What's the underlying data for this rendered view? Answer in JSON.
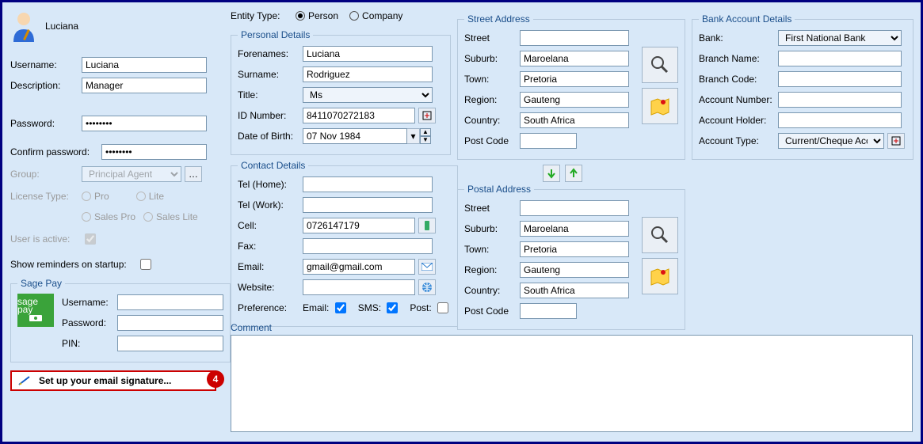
{
  "user": {
    "display_name": "Luciana",
    "username_label": "Username:",
    "username": "Luciana",
    "description_label": "Description:",
    "description": "Manager",
    "password_label": "Password:",
    "password": "********",
    "confirm_label": "Confirm password:",
    "confirm": "********",
    "group_label": "Group:",
    "group_value": "Principal Agent",
    "license_label": "License Type:",
    "license_options": {
      "pro": "Pro",
      "lite": "Lite",
      "salespro": "Sales Pro",
      "saleslite": "Sales Lite"
    },
    "active_label": "User is active:",
    "reminders_label": "Show reminders on startup:"
  },
  "sagepay": {
    "legend": "Sage Pay",
    "logo_top": "sage pay",
    "username_label": "Username:",
    "password_label": "Password:",
    "pin_label": "PIN:"
  },
  "signature": {
    "label": "Set up your email signature...",
    "badge": "4"
  },
  "entity": {
    "type_label": "Entity Type:",
    "person": "Person",
    "company": "Company"
  },
  "personal": {
    "legend": "Personal Details",
    "forenames_label": "Forenames:",
    "forenames": "Luciana",
    "surname_label": "Surname:",
    "surname": "Rodriguez",
    "title_label": "Title:",
    "title": "Ms",
    "id_label": "ID Number:",
    "id": "8411070272183",
    "dob_label": "Date of Birth:",
    "dob": "07 Nov 1984"
  },
  "contact": {
    "legend": "Contact Details",
    "telh_label": "Tel (Home):",
    "telw_label": "Tel (Work):",
    "cell_label": "Cell:",
    "cell": "0726147179",
    "fax_label": "Fax:",
    "email_label": "Email:",
    "email": "gmail@gmail.com",
    "web_label": "Website:",
    "pref_label": "Preference:",
    "pref_email": "Email:",
    "pref_sms": "SMS:",
    "pref_post": "Post:"
  },
  "street": {
    "legend": "Street Address",
    "street_label": "Street",
    "suburb_label": "Suburb:",
    "suburb": "Maroelana",
    "town_label": "Town:",
    "town": "Pretoria",
    "region_label": "Region:",
    "region": "Gauteng",
    "country_label": "Country:",
    "country": "South Africa",
    "post_label": "Post Code"
  },
  "postal": {
    "legend": "Postal Address",
    "street_label": "Street",
    "suburb_label": "Suburb:",
    "suburb": "Maroelana",
    "town_label": "Town:",
    "town": "Pretoria",
    "region_label": "Region:",
    "region": "Gauteng",
    "country_label": "Country:",
    "country": "South Africa",
    "post_label": "Post Code"
  },
  "bank": {
    "legend": "Bank Account Details",
    "bank_label": "Bank:",
    "bank_value": "First National Bank",
    "branchname_label": "Branch Name:",
    "branchcode_label": "Branch Code:",
    "accno_label": "Account Number:",
    "holder_label": "Account Holder:",
    "acctype_label": "Account Type:",
    "acctype_value": "Current/Cheque Acco"
  },
  "comment": {
    "label": "Comment"
  }
}
